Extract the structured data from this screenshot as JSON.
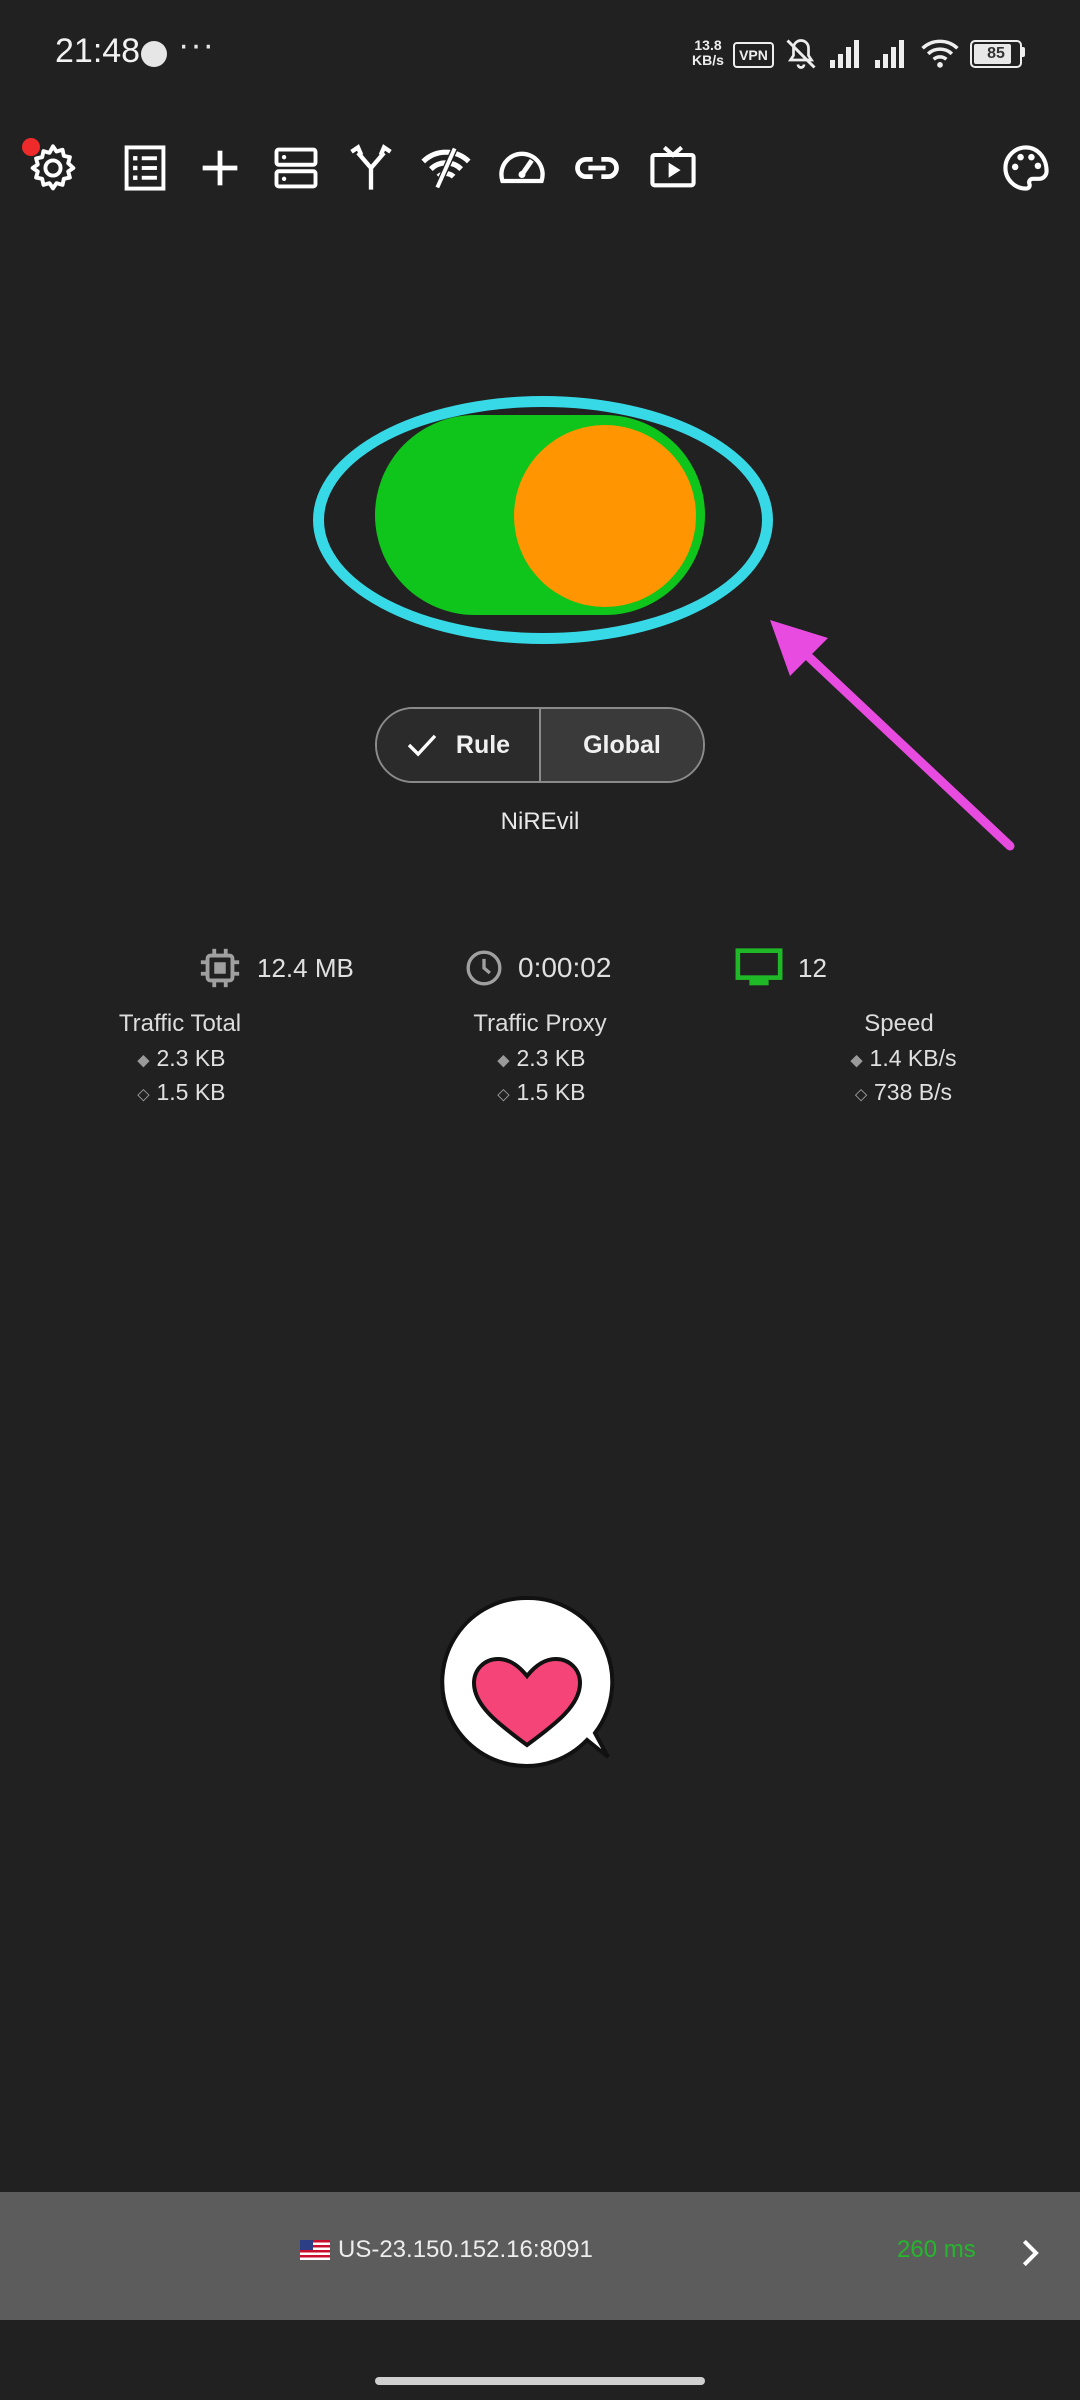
{
  "status_bar": {
    "time": "21:48",
    "more": "···",
    "net_speed_value": "13.8",
    "net_speed_unit": "KB/s",
    "vpn": "VPN",
    "battery": "85",
    "battery_level": 0.85
  },
  "toolbar": {
    "icons": [
      "settings-icon",
      "list-icon",
      "add-icon",
      "servers-icon",
      "routing-icon",
      "wifi-off-icon",
      "speedometer-icon",
      "link-icon",
      "tv-play-icon",
      "palette-icon"
    ]
  },
  "connection": {
    "switch_on": true,
    "colors": {
      "track": "#0fc41a",
      "knob": "#ff9500",
      "highlight": "#38d9e6",
      "annotation_arrow": "#e84be0"
    }
  },
  "mode": {
    "rule": "Rule",
    "global": "Global",
    "selected": "Rule"
  },
  "profile_name": "NiREvil",
  "stats": {
    "memory": "12.4 MB",
    "uptime": "0:00:02",
    "connections": "12",
    "traffic_total": {
      "title": "Traffic Total",
      "up": "2.3 KB",
      "down": "1.5 KB"
    },
    "traffic_proxy": {
      "title": "Traffic Proxy",
      "up": "2.3 KB",
      "down": "1.5 KB"
    },
    "speed": {
      "title": "Speed",
      "up": "1.4 KB/s",
      "down": "738 B/s"
    }
  },
  "server": {
    "label": "US-23.150.152.16:8091",
    "latency": "260 ms"
  }
}
